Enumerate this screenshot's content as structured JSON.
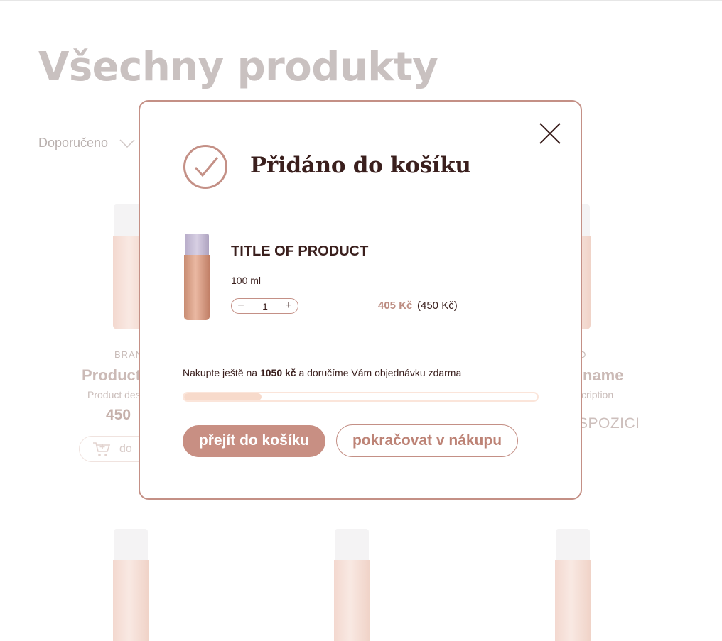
{
  "page": {
    "title": "Všechny produkty",
    "sort_label": "Doporučeno",
    "cards": [
      {
        "brand": "BRAN",
        "name": "Product",
        "description": "Product des",
        "price": "450",
        "cart_button_label": "do"
      },
      {
        "brand": "D",
        "name": "name",
        "description": "cription",
        "availability": "SPOZICI"
      }
    ]
  },
  "modal": {
    "title": "Přidáno do košíku",
    "product": {
      "title": "TITLE OF PRODUCT",
      "volume": "100 ml",
      "quantity": "1",
      "price": "405 Kč",
      "original_price": "(450 Kč)"
    },
    "free_shipping": {
      "prefix": "Nakupte ještě na",
      "amount": "1050 kč",
      "suffix": "a doručíme Vám objednávku zdarma",
      "progress_fraction": 0.22
    },
    "primary_button": "přejít do košíku",
    "secondary_button": "pokračovat v nákupu"
  },
  "colors": {
    "accent": "#c88f83",
    "text_dark": "#3a1f1d",
    "progress_fill": "#f7dacb"
  },
  "icons": {
    "close": "close-icon",
    "check": "check-circle-icon",
    "cart": "cart-icon",
    "sort": "chevron-down-icon"
  }
}
